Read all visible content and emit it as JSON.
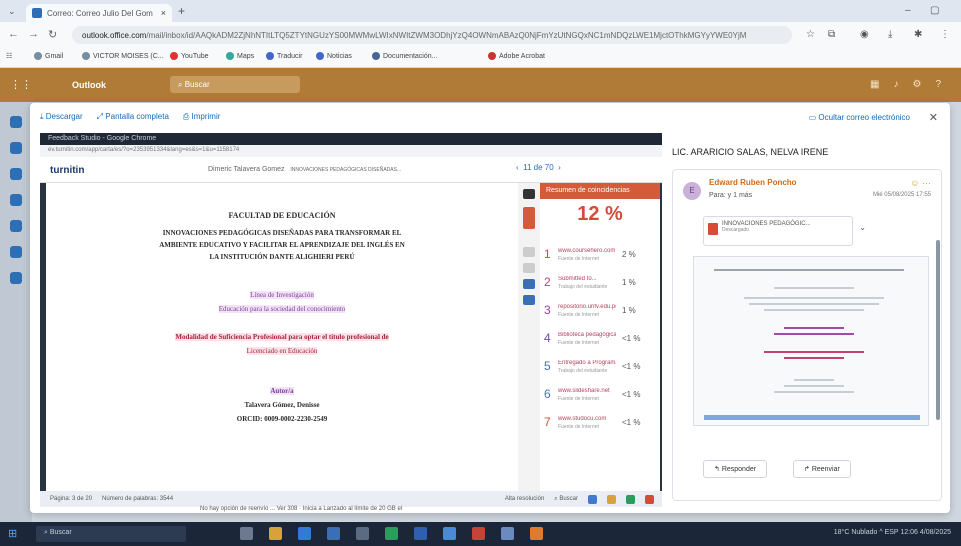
{
  "browser": {
    "tab_title": "Correo: Correo Julio Del Gom",
    "url_prefix": "outlook.office.com",
    "url_rest": "/mail/inbox/id/AAQkADM2ZjNhNTItLTQ5ZTYtNGUzYS00MWMwLWIxNWItZWM3ODhjYzQ4OWNmABAzQ0NjFmYzUtNGQxNC1mNDQzLWE1MjctOThkMGYyYWE0YjM",
    "bookmarks": [
      "Gmail",
      "VICTOR MOISES (C...",
      "YouTube",
      "Maps",
      "Traducir",
      "Noticias",
      "Documentación...",
      "Adobe Acrobat"
    ]
  },
  "outlook": {
    "brand": "Outlook",
    "search_placeholder": "Buscar"
  },
  "viewer": {
    "download": "Descargar",
    "fullscreen": "Pantalla completa",
    "print": "Imprimir",
    "hide_email": "Ocultar correo electrónico"
  },
  "turnitin": {
    "window_title": "Feedback Studio - Google Chrome",
    "url": "ev.turnitin.com/app/carta/es/?o=2353951334&lang=es&s=1&u=1158174",
    "logo": "turnitin",
    "student": "Dimeric Talavera Gomez",
    "paper_title": "INNOVACIONES PEDAGÓGICAS DISEÑADAS...",
    "pager": "11 de 70",
    "doc_lines": [
      "FACULTAD DE EDUCACIÓN",
      "INNOVACIONES PEDAGÓGICAS DISEÑADAS PARA TRANSFORMAR EL",
      "AMBIENTE EDUCATIVO Y FACILITAR EL APRENDIZAJE DEL INGLÉS EN",
      "LA INSTITUCIÓN DANTE ALIGHIERI PERÚ",
      "Línea de Investigación",
      "Educación para la sociedad del conocimiento",
      "Modalidad de Suficiencia Profesional para optar el título profesional de",
      "Licenciado en Educación",
      "Autor/a",
      "Talavera Gómez, Denisse",
      "ORCID: 0009-0002-2230-2549"
    ],
    "similarity_header": "Resumen de coincidencias",
    "similarity": "12 %",
    "matches": [
      {
        "n": "1",
        "src": "www.coursehero.com",
        "type": "Fuente de Internet",
        "pct": "2 %",
        "color": "#d64a3b"
      },
      {
        "n": "2",
        "src": "Submitted to...",
        "type": "Trabajo del estudiante",
        "pct": "1 %",
        "color": "#c2426e"
      },
      {
        "n": "3",
        "src": "repositorio.unfv.edu.pe",
        "type": "Fuente de Internet",
        "pct": "1 %",
        "color": "#a23ea8"
      },
      {
        "n": "4",
        "src": "Biblioteca pedagógica",
        "type": "Fuente de Internet",
        "pct": "<1 %",
        "color": "#6a4cb0"
      },
      {
        "n": "5",
        "src": "Entregado a Programa",
        "type": "Trabajo del estudiante",
        "pct": "<1 %",
        "color": "#3f6fb4"
      },
      {
        "n": "6",
        "src": "www.slideshare.net",
        "type": "Fuente de Internet",
        "pct": "<1 %",
        "color": "#2a84b0"
      },
      {
        "n": "7",
        "src": "www.studocu.com",
        "type": "Fuente de Internet",
        "pct": "<1 %",
        "color": "#d64a3b"
      }
    ],
    "page_info": "Página: 3 de 20",
    "words": "Número de palabras: 3544",
    "text_only": "Alta resolución",
    "windows_search": "Buscar"
  },
  "mail": {
    "subject": "LIC. ARARICIO SALAS, NELVA IRENE",
    "sender": "Edward Ruben Poncho",
    "avatar": "E",
    "to": "Para: y 1 más",
    "date": "Mié 05/08/2025 17:55",
    "attachment_name": "INNOVACIONES PEDAGÓGIC...",
    "attachment_size": "Descargado",
    "reply": "Responder",
    "forward": "Reenviar"
  },
  "notification": "No hay opción de reenvío ... Ver 308 · Inicia a Lanzado al límite de 20 GB el",
  "taskbar": {
    "search": "Buscar",
    "tray": "18°C Nublado   ^  ESP   12:06  4/08/2025"
  }
}
